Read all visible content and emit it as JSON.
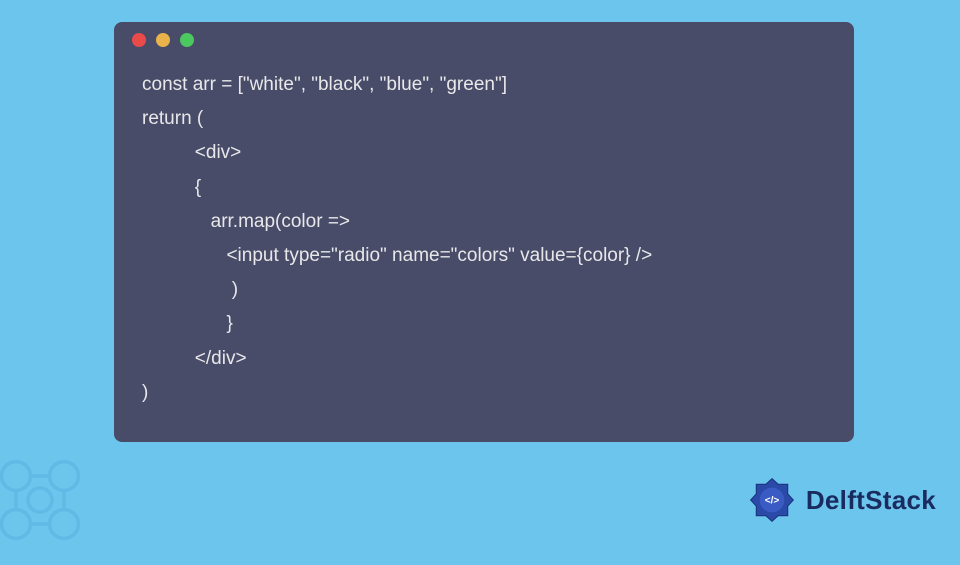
{
  "window": {
    "dots": [
      "red",
      "yellow",
      "green"
    ]
  },
  "code": {
    "line1": "const arr = [\"white\", \"black\", \"blue\", \"green\"]",
    "line2": "return (",
    "line3": "          <div>",
    "line4": "          {",
    "line5": "             arr.map(color =>",
    "line6": "                <input type=\"radio\" name=\"colors\" value={color} />",
    "line7": "                 )",
    "line8": "                }",
    "line9": "          </div>",
    "line10": ")"
  },
  "brand": {
    "name": "DelftStack"
  }
}
